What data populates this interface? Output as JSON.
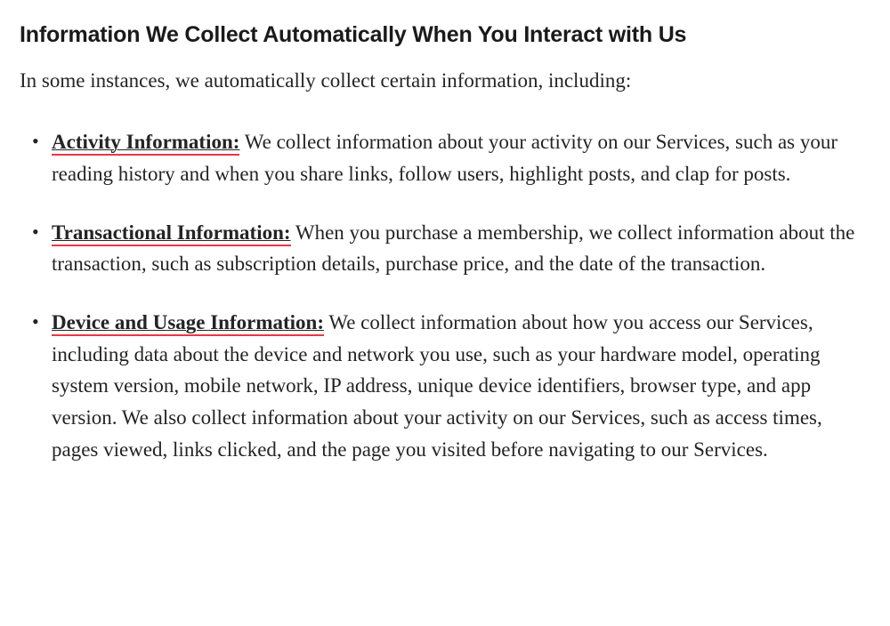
{
  "heading": "Information We Collect Automatically When You Interact with Us",
  "intro": "In some instances, we automatically collect certain information, including:",
  "items": [
    {
      "term": "Activity Information:",
      "body": " We collect information about your activity on our Services, such as your reading history and when you share links, follow users, highlight posts, and clap for posts."
    },
    {
      "term": "Transactional Information:",
      "body": " When you purchase a membership, we collect information about the transaction, such as subscription details, purchase price, and the date of the transaction."
    },
    {
      "term": "Device and Usage Information:",
      "body": " We collect information about how you access our Services, including data about the device and network you use, such as your hardware model, operating system version, mobile network, IP address, unique device identifiers, browser type, and app version. We also collect information about your activity on our Services, such as access times, pages viewed, links clicked, and the page you visited before navigating to our Services."
    }
  ]
}
